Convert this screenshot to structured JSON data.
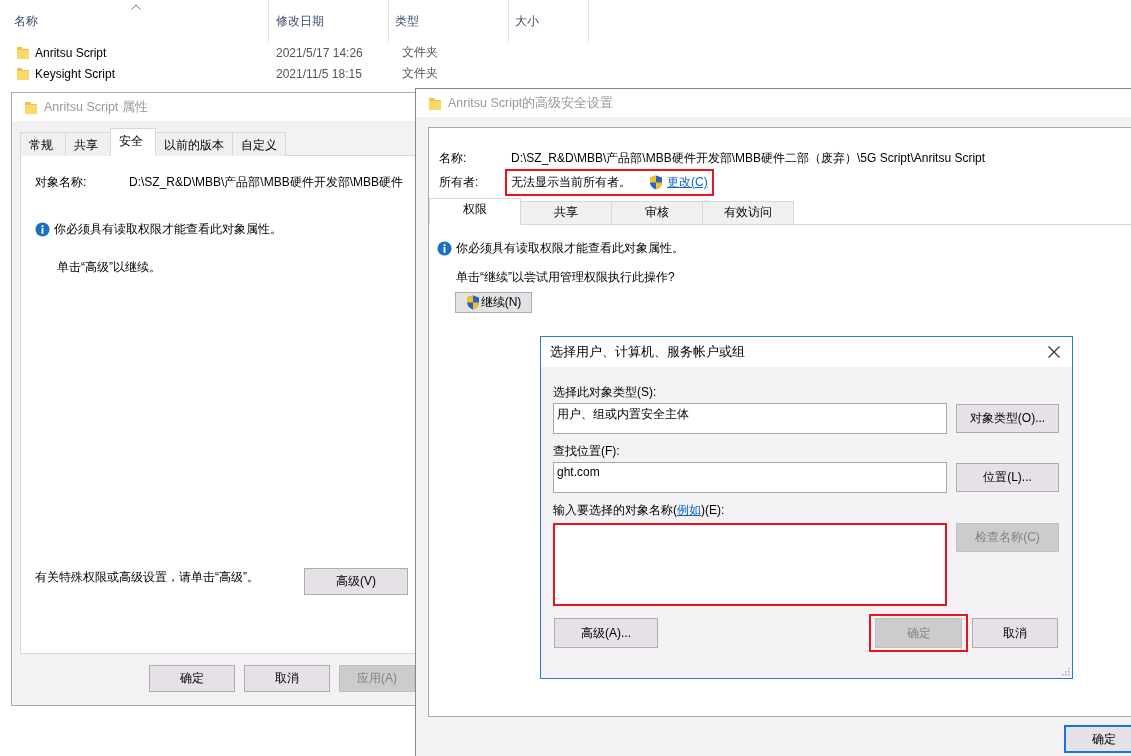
{
  "explorer": {
    "columns": [
      {
        "label": "名称",
        "sorted": true
      },
      {
        "label": "修改日期",
        "sorted": false
      },
      {
        "label": "类型",
        "sorted": false
      },
      {
        "label": "大小",
        "sorted": false
      }
    ],
    "rows": [
      {
        "name": "Anritsu Script",
        "modified": "2021/5/17 14:26",
        "type": "文件夹"
      },
      {
        "name": "Keysight Script",
        "modified": "2021/11/5 18:15",
        "type": "文件夹"
      }
    ]
  },
  "properties_window": {
    "title": "Anritsu Script 属性",
    "tabs": [
      {
        "label": "常规",
        "selected": false
      },
      {
        "label": "共享",
        "selected": false
      },
      {
        "label": "安全",
        "selected": true
      },
      {
        "label": "以前的版本",
        "selected": false
      },
      {
        "label": "自定义",
        "selected": false
      }
    ],
    "object_name_label": "对象名称:",
    "object_name_value": "D:\\SZ_R&D\\MBB\\产品部\\MBB硬件开发部\\MBB硬件",
    "message": "你必须具有读取权限才能查看此对象属性。",
    "hint": "单击“高级”以继续。",
    "advanced_note": "有关特殊权限或高级设置，请单击“高级”。",
    "advanced_button": "高级(V)",
    "buttons": [
      {
        "label": "确定",
        "disabled": false
      },
      {
        "label": "取消",
        "disabled": false
      },
      {
        "label": "应用(A)",
        "disabled": true
      }
    ]
  },
  "advanced_window": {
    "title": "Anritsu Script的高级安全设置",
    "name_label": "名称:",
    "name_value": "D:\\SZ_R&D\\MBB\\产品部\\MBB硬件开发部\\MBB硬件二部（废弃）\\5G Script\\Anritsu Script",
    "owner_label": "所有者:",
    "owner_value": "无法显示当前所有者。",
    "change_link": "更改(C)",
    "owner_highlighted": true,
    "tabs": [
      {
        "label": "权限",
        "selected": true
      },
      {
        "label": "共享",
        "selected": false
      },
      {
        "label": "审核",
        "selected": false
      },
      {
        "label": "有效访问",
        "selected": false
      }
    ],
    "message": "你必须具有读取权限才能查看此对象属性。",
    "hint": "单击“继续”以尝试用管理权限执行此操作?",
    "continue_button": "继续(N)",
    "bottom_button": "确定"
  },
  "select_dialog": {
    "title": "选择用户、计算机、服务帐户或组",
    "type_label": "选择此对象类型(S):",
    "type_value": "用户、组或内置安全主体",
    "type_button": "对象类型(O)...",
    "location_label": "查找位置(F):",
    "location_value": "ght.com",
    "location_button": "位置(L)...",
    "names_label_before": "输入要选择的对象名称(",
    "names_link": "例如",
    "names_label_after": ")(E):",
    "names_highlighted": true,
    "check_button": {
      "label": "检查名称(C)",
      "disabled": true
    },
    "advanced_button": {
      "label": "高级(A)...",
      "disabled": false
    },
    "ok_button": {
      "label": "确定",
      "disabled": true,
      "highlighted": true
    },
    "cancel_button": {
      "label": "取消",
      "disabled": false
    }
  }
}
